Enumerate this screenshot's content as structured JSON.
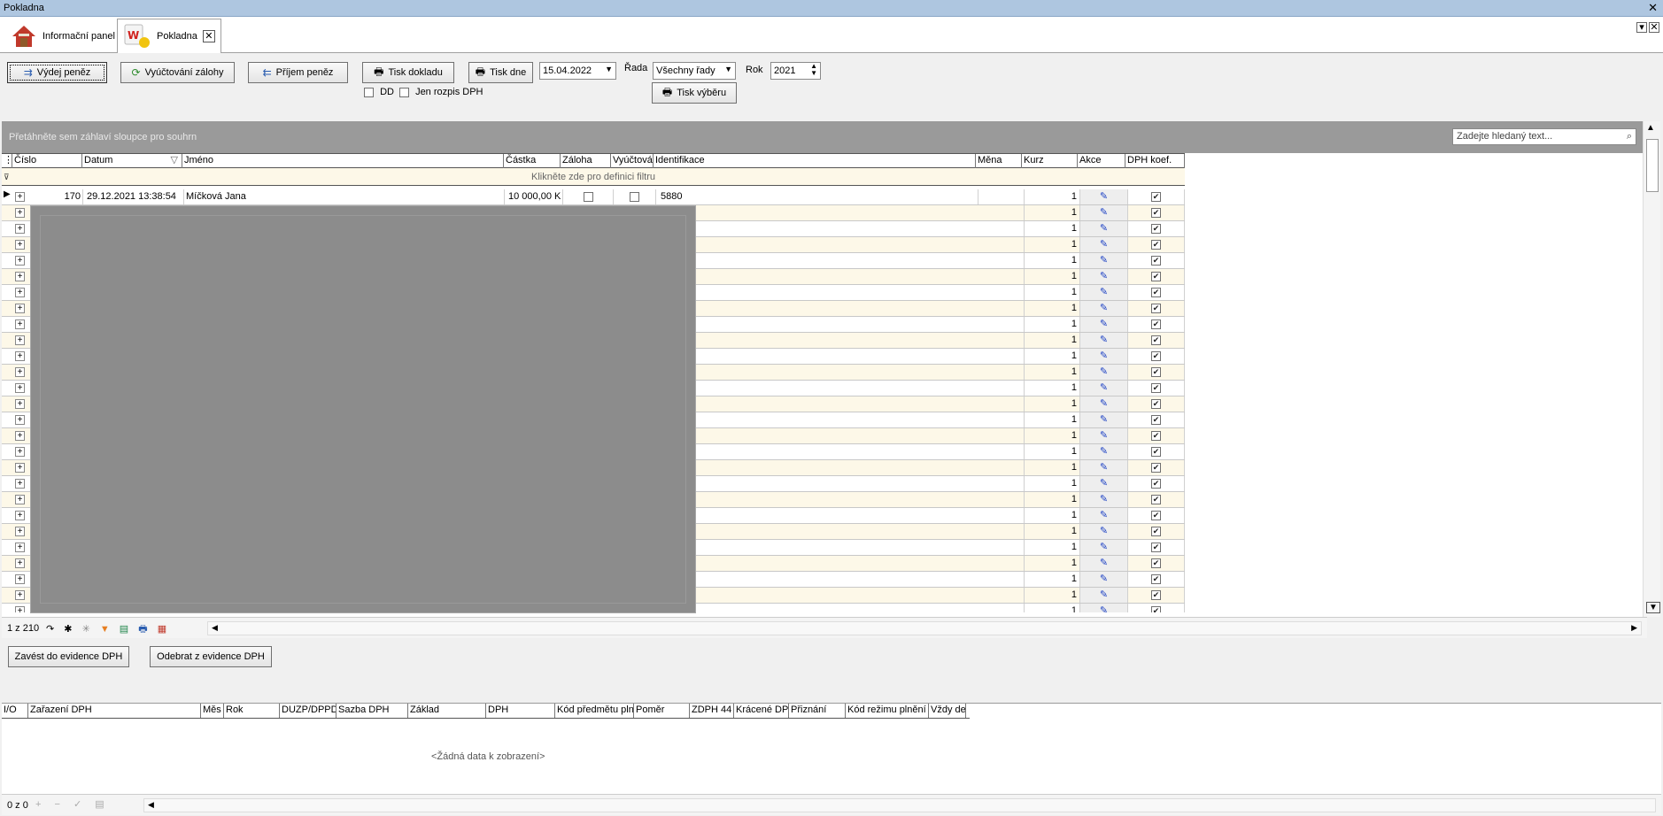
{
  "window": {
    "title": "Pokladna"
  },
  "tabs": [
    {
      "label": "Informační panel"
    },
    {
      "label": "Pokladna"
    }
  ],
  "toolbar": {
    "vydej": "Výdej peněz",
    "vyuctovani": "Vyúčtování zálohy",
    "prijem": "Příjem peněz",
    "tisk_dokladu": "Tisk dokladu",
    "tisk_dne": "Tisk dne",
    "date": "15.04.2022",
    "rada_label": "Řada",
    "rada_value": "Všechny řady",
    "rok_label": "Rok",
    "rok_value": "2021",
    "tisk_vyberu": "Tisk výběru",
    "dd_label": "DD",
    "jen_rozpis_label": "Jen rozpis DPH"
  },
  "grid": {
    "group_hint": "Přetáhněte sem záhlaví sloupce pro souhrn",
    "search_placeholder": "Zadejte hledaný text...",
    "filter_hint": "Klikněte zde pro definici filtru",
    "columns": [
      "Číslo",
      "Datum",
      "Jméno",
      "Částka",
      "Záloha",
      "Vyúčtová",
      "Identifikace",
      "Měna",
      "Kurz",
      "Akce",
      "DPH koef."
    ],
    "first_row": {
      "cislo": "170",
      "datum": "29.12.2021 13:38:54",
      "jmeno": "Míčková Jana",
      "castka": "10 000,00 K",
      "identifikace": "5880",
      "kurz": "1"
    },
    "row_kurz": "1",
    "pager": "1 z 210"
  },
  "buttons": {
    "zavest": "Zavést do evidence DPH",
    "odebrat": "Odebrat z evidence DPH"
  },
  "grid2": {
    "columns": [
      "I/O",
      "Zařazení DPH",
      "Měs",
      "Rok",
      "DUZP/DPPD",
      "Sazba DPH",
      "Základ",
      "DPH",
      "Kód předmětu pln",
      "Poměr",
      "ZDPH 44",
      "Krácené DP",
      "Přiznání",
      "Kód režimu plnění",
      "Vždy de"
    ],
    "empty": "<Žádná data k zobrazení>",
    "pager": "0 z 0"
  }
}
